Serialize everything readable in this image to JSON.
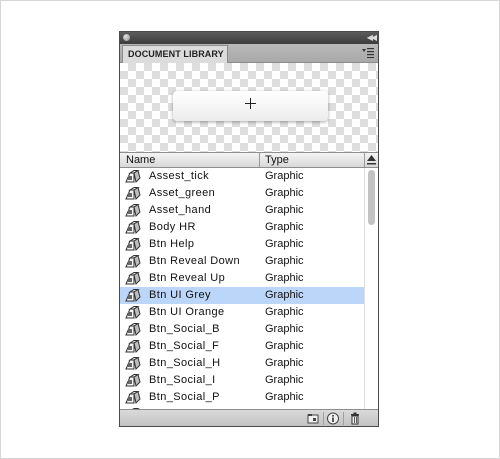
{
  "panel": {
    "tab_label": "DOCUMENT LIBRARY",
    "collapse_icon": "double-chevron-right-icon",
    "menu_icon": "panel-menu-icon"
  },
  "preview": {
    "symbol": "registration-mark-icon"
  },
  "columns": {
    "name": "Name",
    "type": "Type"
  },
  "items": [
    {
      "name": "Assest_tick",
      "type": "Graphic"
    },
    {
      "name": "Asset_green",
      "type": "Graphic"
    },
    {
      "name": "Asset_hand",
      "type": "Graphic"
    },
    {
      "name": "Body HR",
      "type": "Graphic"
    },
    {
      "name": "Btn Help",
      "type": "Graphic"
    },
    {
      "name": "Btn Reveal Down",
      "type": "Graphic"
    },
    {
      "name": "Btn Reveal Up",
      "type": "Graphic"
    },
    {
      "name": "Btn UI Grey",
      "type": "Graphic",
      "selected": true
    },
    {
      "name": "Btn UI Orange",
      "type": "Graphic"
    },
    {
      "name": "Btn_Social_B",
      "type": "Graphic"
    },
    {
      "name": "Btn_Social_F",
      "type": "Graphic"
    },
    {
      "name": "Btn_Social_H",
      "type": "Graphic"
    },
    {
      "name": "Btn_Social_I",
      "type": "Graphic"
    },
    {
      "name": "Btn_Social_P",
      "type": "Graphic"
    },
    {
      "name": "",
      "type": ""
    }
  ],
  "colors": {
    "selection": "#bcd6f9",
    "panel_border": "#4a4a4a"
  },
  "footer_icons": [
    "new-folder-icon",
    "properties-icon",
    "delete-icon"
  ]
}
